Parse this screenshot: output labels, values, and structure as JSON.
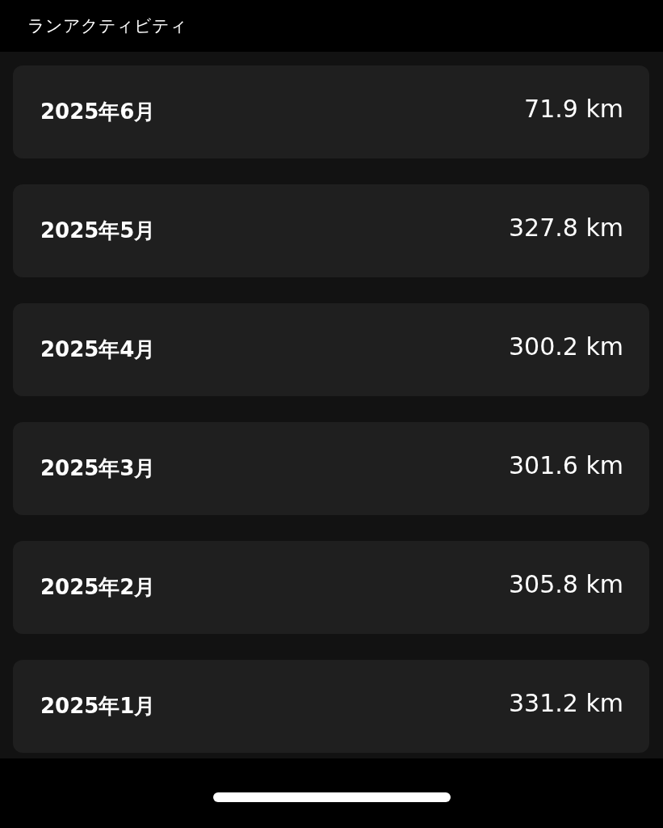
{
  "header": {
    "title": "ランアクティビティ"
  },
  "months": [
    {
      "label": "2025年6月",
      "distance": "71.9 km"
    },
    {
      "label": "2025年5月",
      "distance": "327.8 km"
    },
    {
      "label": "2025年4月",
      "distance": "300.2 km"
    },
    {
      "label": "2025年3月",
      "distance": "301.6 km"
    },
    {
      "label": "2025年2月",
      "distance": "305.8 km"
    },
    {
      "label": "2025年1月",
      "distance": "331.2 km"
    }
  ]
}
